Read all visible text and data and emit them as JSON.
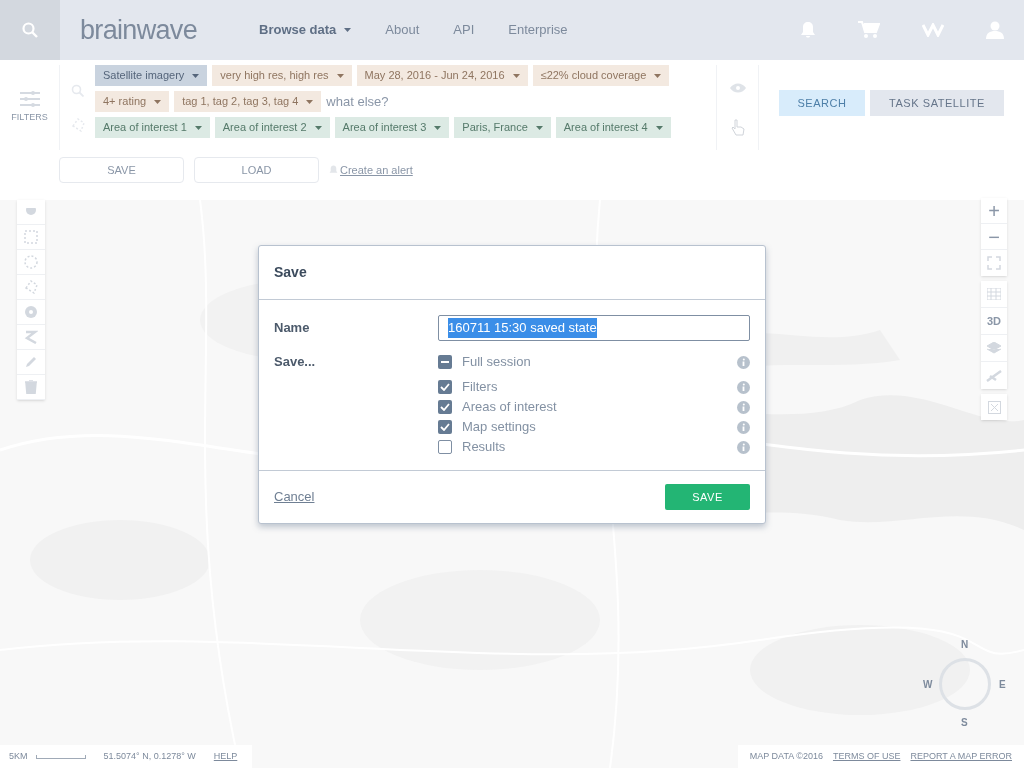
{
  "nav": {
    "logo": "brainwave",
    "items": [
      {
        "label": "Browse data",
        "selected": true,
        "dropdown": true
      },
      {
        "label": "About",
        "selected": false,
        "dropdown": false
      },
      {
        "label": "API",
        "selected": false,
        "dropdown": false
      },
      {
        "label": "Enterprise",
        "selected": false,
        "dropdown": false
      }
    ]
  },
  "filters": {
    "label": "FILTERS",
    "placeholder": "what else?",
    "query_chips": [
      {
        "label": "Satellite imagery",
        "color": "#c9d3df"
      },
      {
        "label": "very high res, high res",
        "color": "#f3e9e0"
      },
      {
        "label": "May 28, 2016 - Jun 24, 2016",
        "color": "#f3e9e0"
      },
      {
        "label": "≤22% cloud coverage",
        "color": "#f3e9e0"
      },
      {
        "label": "4+ rating",
        "color": "#f3e9e0"
      },
      {
        "label": "tag 1, tag 2, tag 3, tag 4",
        "color": "#f3e9e0"
      }
    ],
    "area_chips": [
      {
        "label": "Area of interest 1",
        "color": "#dceae4"
      },
      {
        "label": "Area of interest 2",
        "color": "#dceae4"
      },
      {
        "label": "Area of interest 3",
        "color": "#dceae4"
      },
      {
        "label": "Paris, France",
        "color": "#dceae4"
      },
      {
        "label": "Area of interest 4",
        "color": "#dceae4"
      }
    ],
    "search_button": "SEARCH",
    "task_button": "TASK SATELLITE",
    "save_button": "SAVE",
    "load_button": "LOAD",
    "alert_link": "Create an alert"
  },
  "map": {
    "zoom_in": "+",
    "zoom_out": "−",
    "view_3d": "3D",
    "compass": {
      "n": "N",
      "e": "E",
      "s": "S",
      "w": "W"
    },
    "scale": "5KM",
    "coordinates": "51.5074° N, 0.1278° W",
    "help": "HELP",
    "attribution": "MAP DATA ©2016",
    "terms": "TERMS OF USE",
    "report": "REPORT A MAP ERROR"
  },
  "dialog": {
    "title": "Save",
    "name_label": "Name",
    "name_value": "160711 15:30 saved state",
    "save_label": "Save...",
    "options": [
      {
        "label": "Full session",
        "indeterminate": true
      },
      {
        "label": "Filters",
        "checked": true
      },
      {
        "label": "Areas of interest",
        "checked": true
      },
      {
        "label": "Map settings",
        "checked": true
      },
      {
        "label": "Results",
        "checked": false
      }
    ],
    "cancel": "Cancel",
    "confirm": "SAVE"
  }
}
